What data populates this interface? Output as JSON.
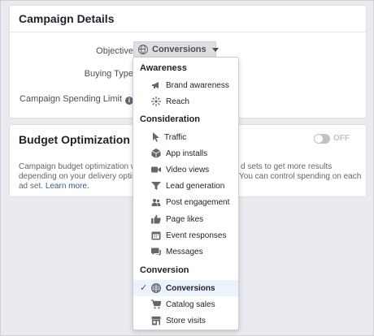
{
  "campaign_details": {
    "title": "Campaign Details",
    "objective_label": "Objective",
    "objective_value": "Conversions",
    "buying_type_label": "Buying Type",
    "spending_limit_label": "Campaign Spending Limit",
    "info_glyph": "i"
  },
  "budget_optimization": {
    "title": "Budget Optimization",
    "toggle_state": "OFF",
    "desc_line1_a": "Campaign budget optimization wil",
    "desc_line1_b": "d sets to get more results",
    "desc_line2_a": "depending on your delivery optimiz",
    "desc_line2_b": "You can control spending on each",
    "desc_line3": "ad set.",
    "learn_more": "Learn more."
  },
  "objective_menu": {
    "sections": [
      {
        "label": "Awareness"
      },
      {
        "label": "Consideration"
      },
      {
        "label": "Conversion"
      }
    ],
    "items": [
      {
        "label": "Brand awareness",
        "icon": "megaphone-icon"
      },
      {
        "label": "Reach",
        "icon": "reach-icon"
      },
      {
        "label": "Traffic",
        "icon": "cursor-icon"
      },
      {
        "label": "App installs",
        "icon": "cube-icon"
      },
      {
        "label": "Video views",
        "icon": "video-camera-icon"
      },
      {
        "label": "Lead generation",
        "icon": "funnel-icon"
      },
      {
        "label": "Post engagement",
        "icon": "people-icon"
      },
      {
        "label": "Page likes",
        "icon": "thumbs-up-icon"
      },
      {
        "label": "Event responses",
        "icon": "calendar-icon"
      },
      {
        "label": "Messages",
        "icon": "chat-bubble-icon"
      },
      {
        "label": "Conversions",
        "icon": "globe-icon",
        "selected": true
      },
      {
        "label": "Catalog sales",
        "icon": "shopping-cart-icon"
      },
      {
        "label": "Store visits",
        "icon": "store-icon"
      }
    ],
    "check_glyph": "✓"
  },
  "colors": {
    "page_bg": "#e9ebee",
    "link": "#365899",
    "selected_bg": "#ecf3ff",
    "icon_gray": "#606770"
  }
}
